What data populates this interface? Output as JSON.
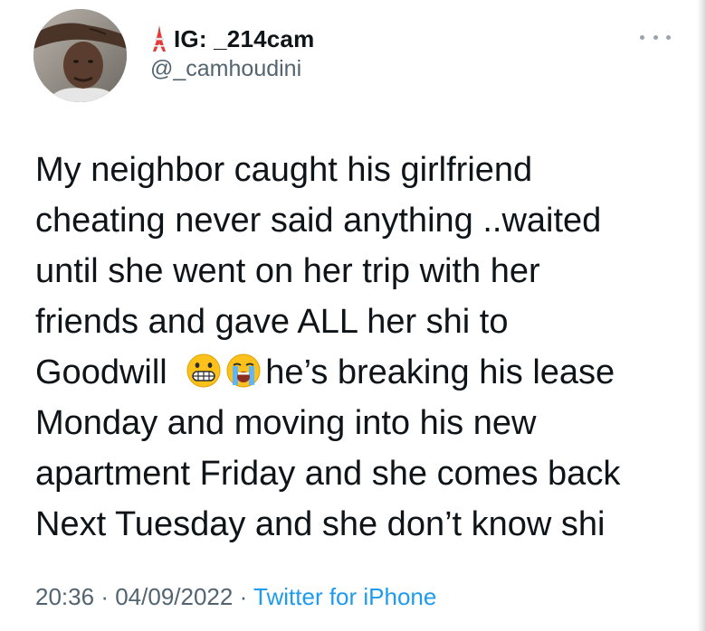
{
  "author": {
    "display_name": "IG: _214cam",
    "handle": "@_camhoudini",
    "name_icon": "tokyo-tower-icon",
    "avatar": "profile-photo"
  },
  "tweet": {
    "lines": [
      "My neighbor caught his girlfriend",
      "cheating never said anything ..waited",
      "until she went on her trip with her",
      "friends and gave ALL her shi to",
      "Goodwill",
      "he’s breaking his lease",
      "Monday and moving into his new",
      "apartment Friday and she comes back",
      "Next Tuesday and she don’t know shi"
    ],
    "emojis": [
      "grimacing-face-emoji",
      "loudly-crying-face-emoji"
    ]
  },
  "meta": {
    "time": "20:36",
    "separator": "·",
    "date": "04/09/2022",
    "source": "Twitter for iPhone"
  },
  "menu": {
    "icon": "more-options-icon"
  }
}
